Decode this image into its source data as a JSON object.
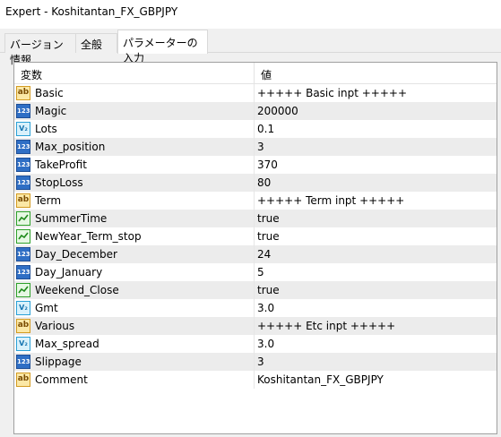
{
  "window": {
    "title": "Expert - Koshitantan_FX_GBPJPY"
  },
  "tabs": [
    {
      "label": "バージョン情報"
    },
    {
      "label": "全般"
    },
    {
      "label": "パラメーターの入力"
    }
  ],
  "table": {
    "headers": {
      "variable": "変数",
      "value": "値"
    },
    "rows": [
      {
        "icon": "string-ab-icon",
        "name": "Basic",
        "value": "+++++ Basic inpt +++++"
      },
      {
        "icon": "integer-123-icon",
        "name": "Magic",
        "value": "200000"
      },
      {
        "icon": "double-v2-icon",
        "name": "Lots",
        "value": "0.1"
      },
      {
        "icon": "integer-123-icon",
        "name": "Max_position",
        "value": "3"
      },
      {
        "icon": "integer-123-icon",
        "name": "TakeProfit",
        "value": "370"
      },
      {
        "icon": "integer-123-icon",
        "name": "StopLoss",
        "value": "80"
      },
      {
        "icon": "string-ab-icon",
        "name": "Term",
        "value": "+++++ Term inpt +++++"
      },
      {
        "icon": "bool-icon",
        "name": "SummerTime",
        "value": "true"
      },
      {
        "icon": "bool-icon",
        "name": "NewYear_Term_stop",
        "value": "true"
      },
      {
        "icon": "integer-123-icon",
        "name": "Day_December",
        "value": "24"
      },
      {
        "icon": "integer-123-icon",
        "name": "Day_January",
        "value": "5"
      },
      {
        "icon": "bool-icon",
        "name": "Weekend_Close",
        "value": "true"
      },
      {
        "icon": "double-v2-icon",
        "name": "Gmt",
        "value": "3.0"
      },
      {
        "icon": "string-ab-icon",
        "name": "Various",
        "value": " +++++ Etc inpt +++++"
      },
      {
        "icon": "double-v2-icon",
        "name": "Max_spread",
        "value": "3.0"
      },
      {
        "icon": "integer-123-icon",
        "name": "Slippage",
        "value": "3"
      },
      {
        "icon": "string-ab-icon",
        "name": "Comment",
        "value": "Koshitantan_FX_GBPJPY"
      }
    ]
  }
}
